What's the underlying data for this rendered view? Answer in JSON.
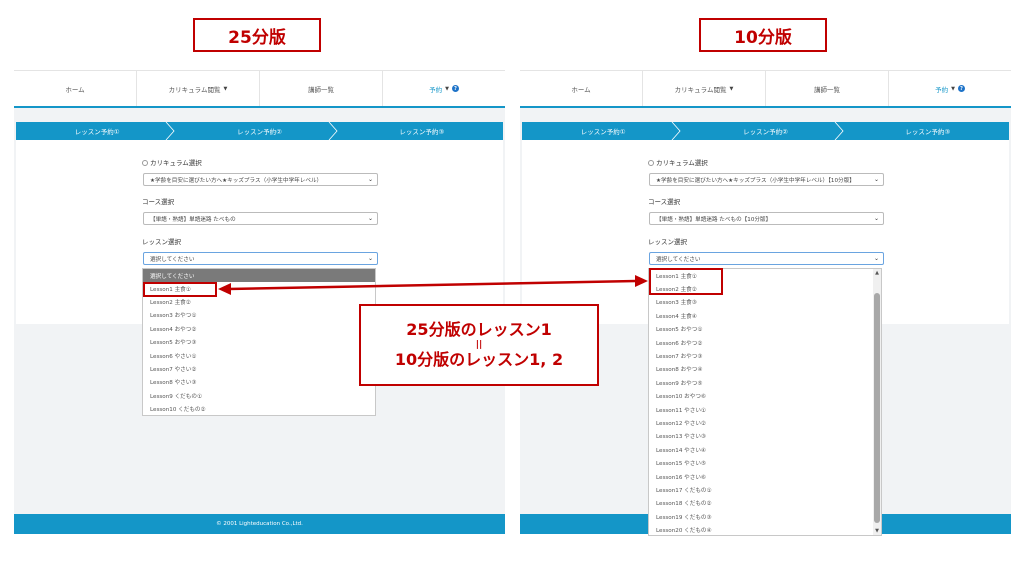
{
  "labels": {
    "left": "25分版",
    "right": "10分版"
  },
  "nav": {
    "home": "ホーム",
    "curriculum": "カリキュラム閲覧",
    "teachers": "講師一覧",
    "booking": "予約",
    "help_icon": "help-icon",
    "help_glyph": "?"
  },
  "steps": [
    "レッスン予約①",
    "レッスン予約②",
    "レッスン予約③"
  ],
  "form": {
    "curriculum_label": "カリキュラム選択",
    "course_label": "コース選択",
    "lesson_label": "レッスン選択",
    "lesson_placeholder": "選択してください"
  },
  "left": {
    "curriculum_value": "★学齢を目安に選びたい方へ★キッズプラス（小学生中学年レベル）",
    "course_value": "【単語・熟語】単語迷路 たべもの",
    "dropdown_header": "選択してください",
    "lessons": [
      "Lesson1 主食①",
      "Lesson2 主食②",
      "Lesson3 おやつ①",
      "Lesson4 おやつ②",
      "Lesson5 おやつ③",
      "Lesson6 やさい①",
      "Lesson7 やさい②",
      "Lesson8 やさい③",
      "Lesson9 くだもの①",
      "Lesson10 くだもの②"
    ]
  },
  "right": {
    "curriculum_value": "★学齢を目安に選びたい方へ★キッズプラス（小学生中学年レベル）【10分版】",
    "course_value": "【単語・熟語】単語迷路 たべもの【10分版】",
    "lessons": [
      "Lesson1 主食①",
      "Lesson2 主食②",
      "Lesson3 主食③",
      "Lesson4 主食④",
      "Lesson5 おやつ①",
      "Lesson6 おやつ②",
      "Lesson7 おやつ③",
      "Lesson8 おやつ④",
      "Lesson9 おやつ⑤",
      "Lesson10 おやつ⑥",
      "Lesson11 やさい①",
      "Lesson12 やさい②",
      "Lesson13 やさい③",
      "Lesson14 やさい④",
      "Lesson15 やさい⑤",
      "Lesson16 やさい⑥",
      "Lesson17 くだもの①",
      "Lesson18 くだもの②",
      "Lesson19 くだもの③",
      "Lesson20 くだもの④"
    ]
  },
  "footer": {
    "copyright": "© 2001 Lighteducation Co.,Ltd."
  },
  "callout": {
    "line1": "25分版のレッスン1",
    "line2": "||",
    "line3": "10分版のレッスン1, 2"
  },
  "colors": {
    "accent": "#1496c8",
    "highlight": "#c00000"
  }
}
